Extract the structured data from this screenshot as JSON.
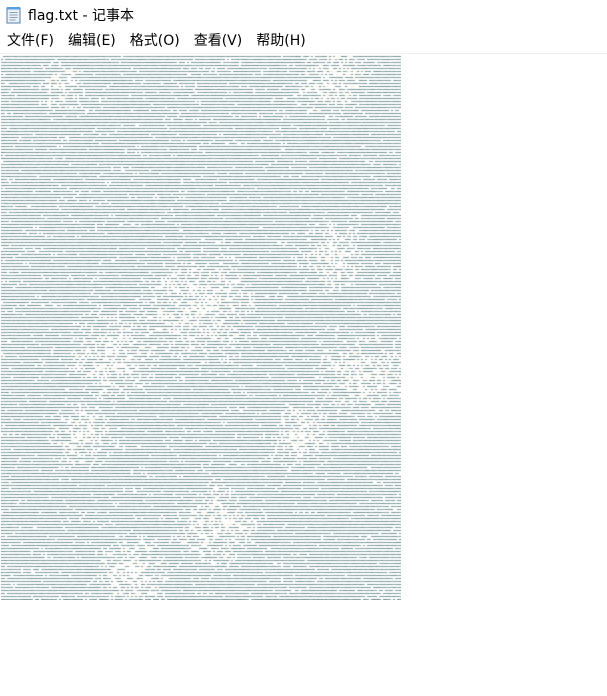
{
  "window": {
    "title": "flag.txt - 记事本"
  },
  "menubar": {
    "items": [
      {
        "label": "文件(F)"
      },
      {
        "label": "编辑(E)"
      },
      {
        "label": "格式(O)"
      },
      {
        "label": "查看(V)"
      },
      {
        "label": "帮助(H)"
      }
    ]
  },
  "editor": {
    "content_description": "dense block of repeated text characters forming a faint image pattern",
    "colors": {
      "text": "#6f8f8f",
      "highlight": "#f4ecdc",
      "background": "#ffffff"
    }
  },
  "icons": {
    "title_icon": "notepad-icon"
  }
}
